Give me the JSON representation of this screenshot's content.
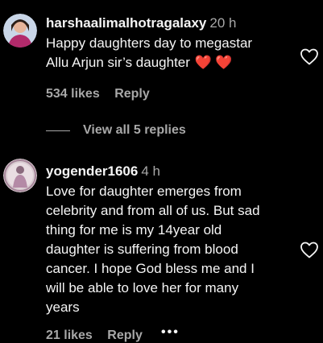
{
  "comments": [
    {
      "username": "harshaalimalhotragalaxy",
      "time": "20 h",
      "lines": [
        "Happy daughters day to megastar",
        "Allu Arjun sir’s daughter"
      ],
      "hearts": "❤️❤️",
      "likes": "534 likes",
      "reply_label": "Reply",
      "view_replies": "View all 5 replies"
    },
    {
      "username": "yogender1606",
      "time": "4 h",
      "lines": [
        "Love for daughter emerges from",
        "celebrity and from all of us. But sad",
        "thing for me is my 14year old",
        "daughter is suffering from blood",
        "cancer. I hope God bless me and I",
        "will be able to love her for many",
        "years"
      ],
      "likes": "21 likes",
      "reply_label": "Reply",
      "more": "•••"
    }
  ],
  "icons": {
    "like": "heart-outline-icon",
    "more": "more-options-icon"
  },
  "colors": {
    "background": "#000000",
    "text": "#f5f5f5",
    "muted": "#a8a8a8",
    "heart": "#ff3040"
  }
}
